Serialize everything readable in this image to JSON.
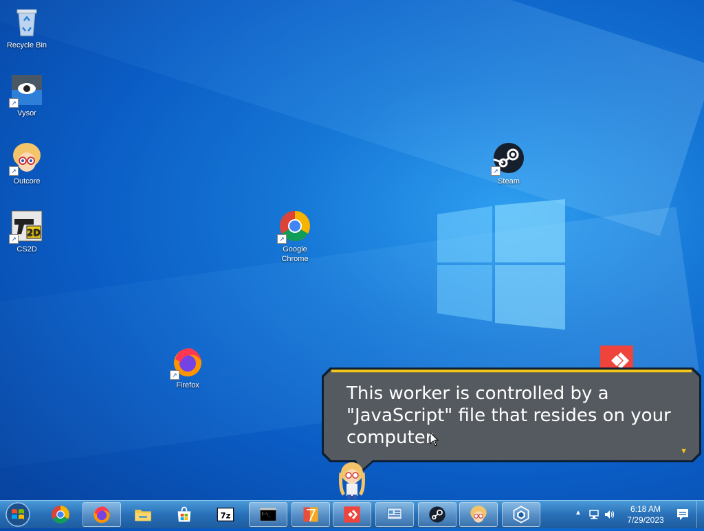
{
  "desktop": {
    "icons": [
      {
        "label": "Recycle Bin",
        "icon": "recycle-bin-icon"
      },
      {
        "label": "Vysor",
        "icon": "vysor-icon"
      },
      {
        "label": "Outcore",
        "icon": "outcore-icon"
      },
      {
        "label": "CS2D",
        "icon": "cs2d-icon"
      },
      {
        "label": "Google Chrome",
        "icon": "chrome-icon"
      },
      {
        "label": "Firefox",
        "icon": "firefox-icon"
      },
      {
        "label": "Steam",
        "icon": "steam-icon"
      }
    ]
  },
  "dialog": {
    "text": "This worker is controlled by a \"JavaScript\" file that resides on your computer.",
    "continue_indicator": "▼"
  },
  "taskbar": {
    "start_icon": "windows-start-icon",
    "pinned": [
      {
        "name": "Google Chrome",
        "icon": "chrome-icon",
        "open": false
      },
      {
        "name": "Firefox",
        "icon": "firefox-icon",
        "open": true
      },
      {
        "name": "File Explorer",
        "icon": "folder-icon",
        "open": false
      },
      {
        "name": "Microsoft Store",
        "icon": "store-icon",
        "open": false
      },
      {
        "name": "7-Zip",
        "icon": "7zip-icon",
        "open": false
      },
      {
        "name": "Command Prompt",
        "icon": "cmd-icon",
        "open": true
      },
      {
        "name": "Notepad++",
        "icon": "notepad-icon",
        "open": true
      },
      {
        "name": "AnyDesk",
        "icon": "anydesk-icon",
        "open": true
      },
      {
        "name": "Control Panel",
        "icon": "control-panel-icon",
        "open": true
      },
      {
        "name": "Steam",
        "icon": "steam-icon",
        "open": true
      },
      {
        "name": "Outcore",
        "icon": "outcore-icon",
        "open": true
      },
      {
        "name": "Unity",
        "icon": "unity-icon",
        "open": true
      }
    ],
    "cmd_label": "C:\\_",
    "zip_label": "7z",
    "cs2d_label": "2D",
    "clock": {
      "time": "6:18 AM",
      "date": "7/29/2023"
    }
  }
}
